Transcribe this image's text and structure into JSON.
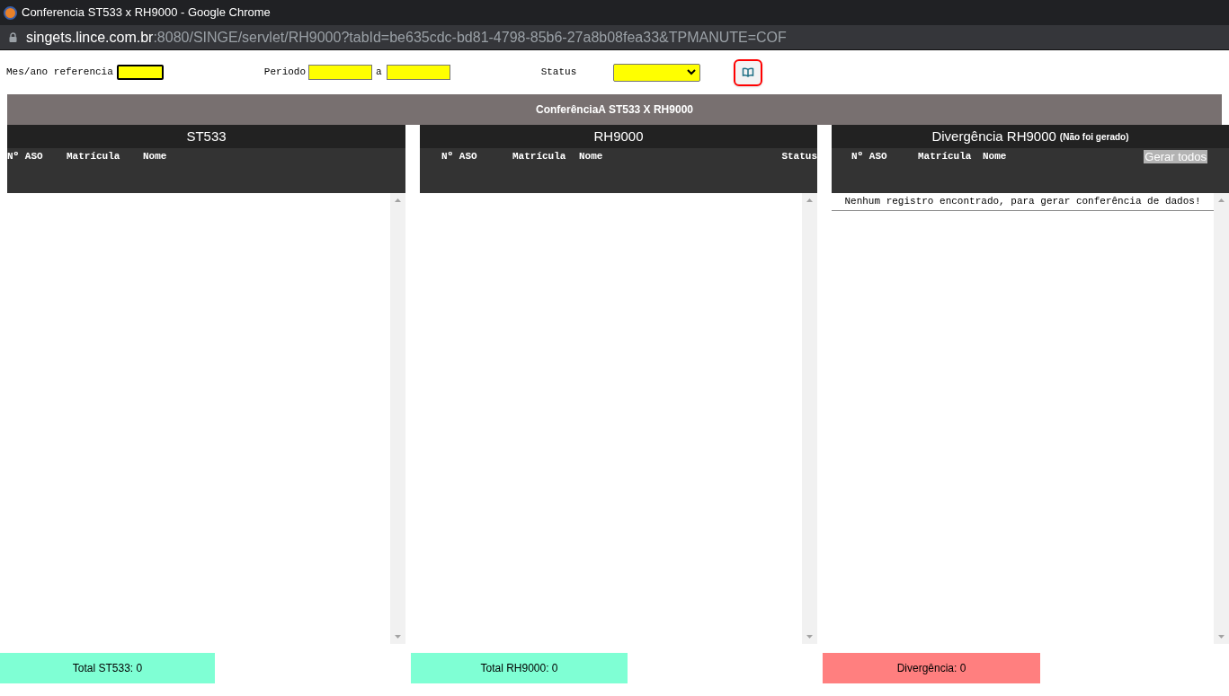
{
  "window": {
    "title": "Conferencia ST533 x RH9000 - Google Chrome"
  },
  "address_bar": {
    "host": "singets.lince.com.br",
    "path": ":8080/SINGE/servlet/RH9000?tabId=be635cdc-bd81-4798-85b6-27a8b08fea33&TPMANUTE=COF"
  },
  "filters": {
    "month_label": "Mes/ano referencia",
    "period_label": "Periodo",
    "period_separator": "a",
    "status_label": "Status"
  },
  "banner": {
    "title": "ConferênciaA ST533 X RH9000"
  },
  "panels": [
    {
      "title": "ST533",
      "columns": [
        "Nº ASO",
        "Matrícula",
        "Nome"
      ]
    },
    {
      "title": "RH9000",
      "columns": [
        "Nº ASO",
        "Matrícula",
        "Nome",
        "Status"
      ]
    },
    {
      "title": "Divergência RH9000",
      "subtitle": "(Não foi gerado)",
      "columns": [
        "Nº ASO",
        "Matrícula",
        "Nome"
      ],
      "button": "Gerar todos",
      "message": "Nenhum registro encontrado, para gerar conferência de dados!"
    }
  ],
  "totals": [
    {
      "text": "Total ST533: 0",
      "color": "#7fffd4"
    },
    {
      "text": "Total RH9000: 0",
      "color": "#7fffd4"
    },
    {
      "text": "Divergência: 0",
      "color": "#ff7f7f"
    }
  ]
}
